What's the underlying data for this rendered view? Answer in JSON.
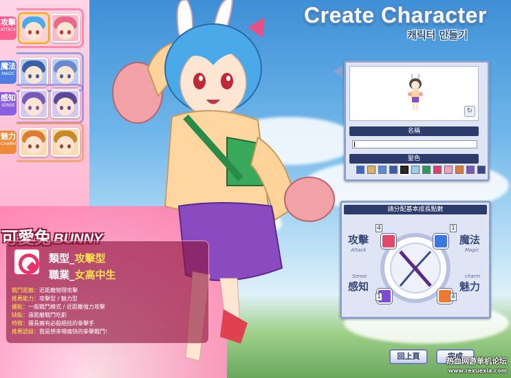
{
  "title": "Create Character",
  "subtitle": "캐릭터 만들기",
  "categories": [
    {
      "label": "攻擊",
      "label_en": "ATTACK",
      "color": "#ff5f8f"
    },
    {
      "label": "魔法",
      "label_en": "MAGIC",
      "color": "#4f7ee0"
    },
    {
      "label": "感知",
      "label_en": "SENSE",
      "color": "#8a5fe0"
    },
    {
      "label": "魅力",
      "label_en": "CHARM",
      "color": "#f08a3a"
    }
  ],
  "character": {
    "name": "可愛兔",
    "name_en": "BUNNY",
    "type_label": "類型_",
    "type_value": "攻擊型",
    "job_label": "職業_",
    "job_value": "女高中生",
    "details": [
      {
        "k": "戰鬥距離：",
        "v": "近距離物理攻擊"
      },
      {
        "k": "推薦能力：",
        "v": "攻擊型 / 魅力型"
      },
      {
        "k": "優點：",
        "v": "一般戰鬥模式 / 近距離強力攻擊"
      },
      {
        "k": "缺點：",
        "v": "遠距離戰鬥吃虧"
      },
      {
        "k": "特徵：",
        "v": "擅長擁有必殺絕技的拳擊手"
      },
      {
        "k": "推薦語錄：",
        "v": "我是想來場痛快的拳擊戰鬥!"
      }
    ]
  },
  "preview": {
    "name_label": "名稱",
    "name_value": "",
    "color_label": "髮色",
    "colors": [
      "#3f66b8",
      "#e2b25a",
      "#5c8ad6",
      "#3a5ea8",
      "#2a2a2a",
      "#9ad0e8",
      "#2f9a58",
      "#e0406a",
      "#f0a0b8",
      "#e07a30",
      "#7a5ab8",
      "#3a4a88"
    ],
    "selected_color": 4
  },
  "stats": {
    "header": "請分配基本成長點數",
    "attack": {
      "zh": "攻擊",
      "en": "Attack",
      "value": "4",
      "color": "#e04a6a"
    },
    "magic": {
      "zh": "魔法",
      "en": "Magic",
      "value": "1",
      "color": "#3a7ae0"
    },
    "sense": {
      "zh": "感知",
      "en": "Sense",
      "value": "1",
      "color": "#7a4ad8"
    },
    "charm": {
      "zh": "魅力",
      "en": "charm",
      "value": "4",
      "color": "#f07a30"
    }
  },
  "buttons": {
    "back": "回上頁",
    "done": "完成"
  },
  "watermark": {
    "line1": "热血网游单机论坛",
    "line2": "www.rexuexia.com"
  }
}
